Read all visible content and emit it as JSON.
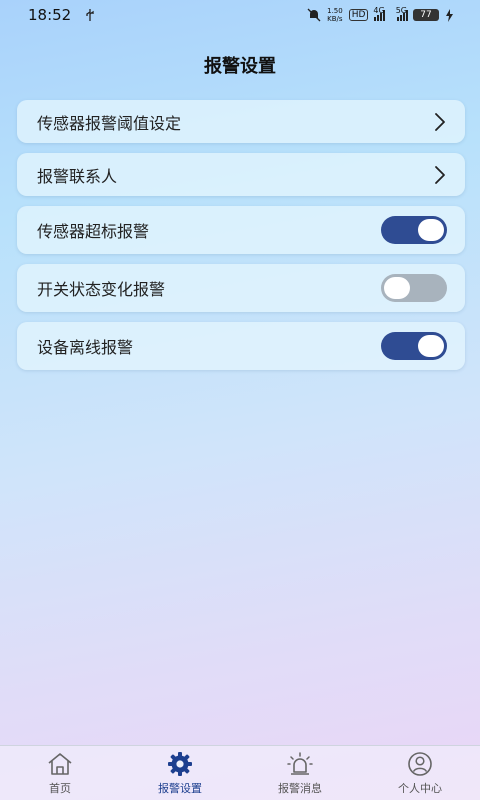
{
  "status_bar": {
    "time": "18:52",
    "usb_icon": "usb-icon",
    "net_speed": "1.50\nKB/s",
    "hd_label": "HD",
    "net_4g": "4G",
    "net_5g": "5G",
    "battery": "77"
  },
  "page": {
    "title": "报警设置"
  },
  "settings": [
    {
      "label": "传感器报警阈值设定",
      "control": "chevron"
    },
    {
      "label": "报警联系人",
      "control": "chevron"
    },
    {
      "label": "传感器超标报警",
      "control": "switch",
      "on": true
    },
    {
      "label": "开关状态变化报警",
      "control": "switch",
      "on": false
    },
    {
      "label": "设备离线报警",
      "control": "switch",
      "on": true
    }
  ],
  "tab_bar": {
    "tabs": [
      {
        "label": "首页",
        "icon": "home-icon",
        "active": false
      },
      {
        "label": "报警设置",
        "icon": "gear-icon",
        "active": true
      },
      {
        "label": "报警消息",
        "icon": "alarm-light-icon",
        "active": false
      },
      {
        "label": "个人中心",
        "icon": "profile-icon",
        "active": false
      }
    ]
  },
  "colors": {
    "switch_on": "#2f4c93",
    "switch_off": "#a8b3bd",
    "active_tab": "#1d3f8f"
  }
}
